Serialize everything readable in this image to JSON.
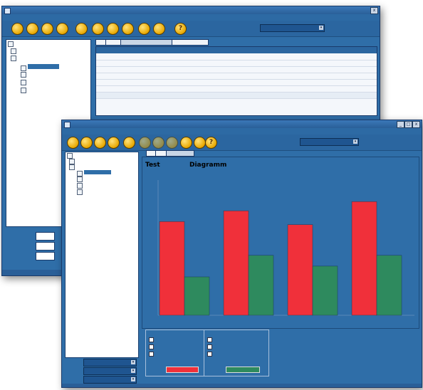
{
  "back_window": {
    "title": "",
    "menu": [
      "",
      "",
      "",
      "",
      "",
      ""
    ],
    "toolbar_buttons": [
      "new-icon",
      "open-icon",
      "save-icon",
      "print-icon",
      "user-icon",
      "back-icon",
      "forward-icon",
      "refresh-icon",
      "export-icon",
      "import-icon",
      "help-icon"
    ],
    "help_glyph": "?",
    "filter_label": "",
    "filter_value": "",
    "tree_items": [
      "",
      "",
      "",
      "",
      "",
      "",
      ""
    ],
    "tabs": [
      "",
      "",
      "",
      ""
    ],
    "bottom_fields": [
      {
        "label": "",
        "value": ""
      },
      {
        "label": "",
        "value": ""
      },
      {
        "label": "",
        "value": ""
      }
    ],
    "status_text": ""
  },
  "front_window": {
    "title": "",
    "menu": [
      "",
      "",
      "",
      "",
      "",
      "",
      ""
    ],
    "help_glyph": "?",
    "filter_label": "",
    "filter_value": "",
    "tree_items": [
      "",
      "",
      "",
      "",
      "",
      "",
      ""
    ],
    "tabs": [
      "",
      "",
      ""
    ],
    "chart_heading_left": "Test",
    "chart_heading_right": "Diagramm",
    "legend_left_title": "",
    "legend_left_items": [
      "",
      "",
      "",
      ""
    ],
    "legend_right_title": "",
    "legend_right_items": [
      "",
      "",
      "",
      ""
    ],
    "bottom_fields": [
      {
        "label": "",
        "value": ""
      },
      {
        "label": "",
        "value": ""
      },
      {
        "label": "",
        "value": ""
      }
    ],
    "colors": {
      "series_red": "#f0303a",
      "series_green": "#2e8a5e",
      "background": "#2f6ea8"
    }
  },
  "chart_data": {
    "type": "bar",
    "categories": [
      "",
      "",
      "",
      ""
    ],
    "series": [
      {
        "values": [
          6.1,
          6.8,
          5.9,
          7.4
        ]
      },
      {
        "values": [
          2.5,
          3.9,
          3.2,
          3.9
        ]
      }
    ],
    "ylim": [
      0,
      8.8
    ],
    "grid": false,
    "title": "Test Diagramm"
  }
}
